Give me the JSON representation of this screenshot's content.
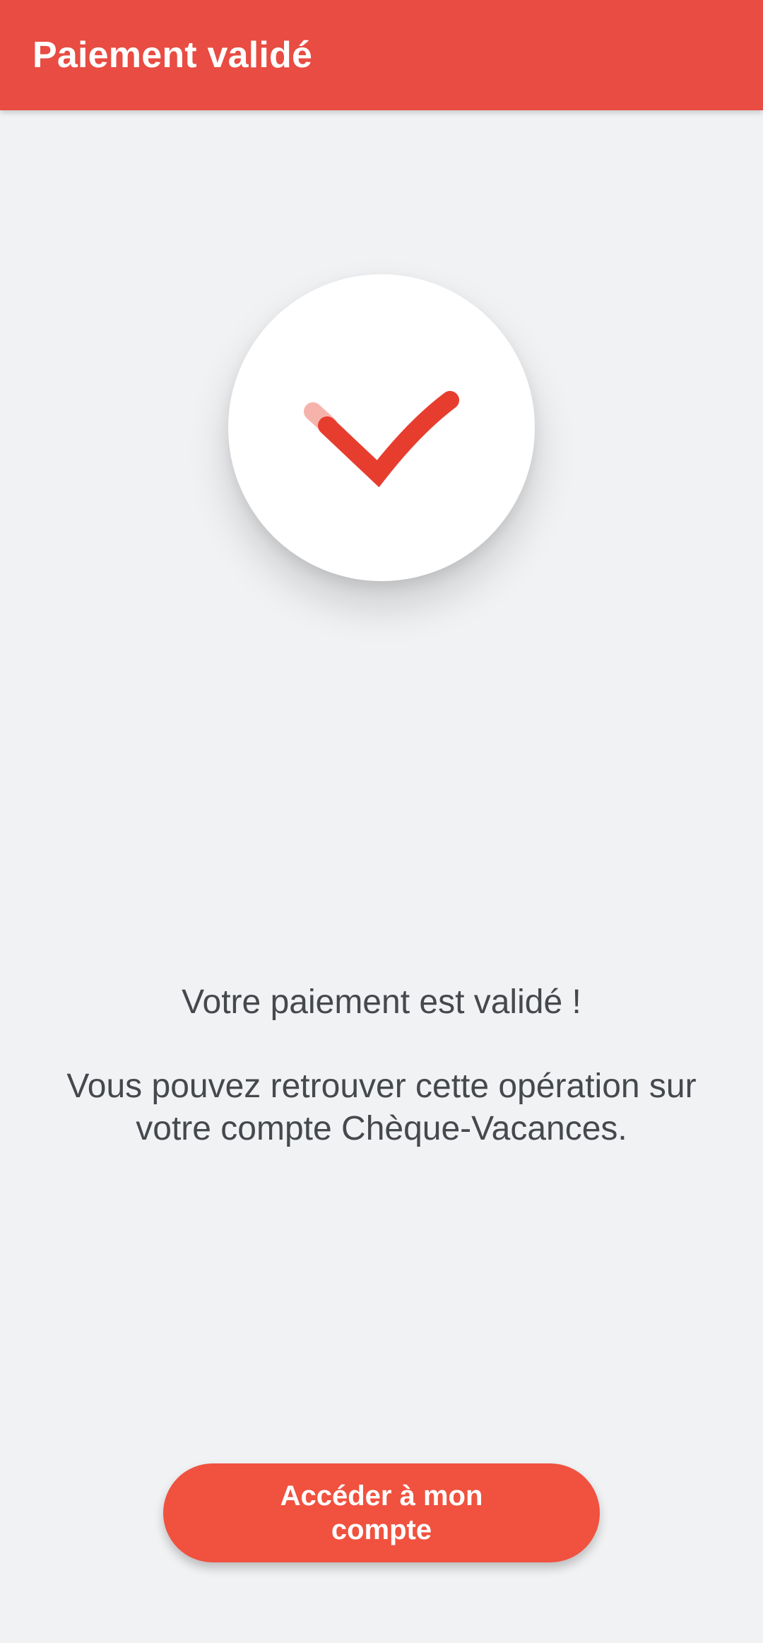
{
  "header": {
    "title": "Paiement validé",
    "background_color": "#e84c42"
  },
  "status": {
    "icon": "checkmark-icon",
    "accent_color": "#e73d2f"
  },
  "message": {
    "title": "Votre paiement est validé !",
    "body": "Vous pouvez retrouver cette opération sur votre compte Chèque-Vacances."
  },
  "actions": {
    "primary_label": "Accéder à mon compte",
    "primary_color": "#f0523f"
  }
}
